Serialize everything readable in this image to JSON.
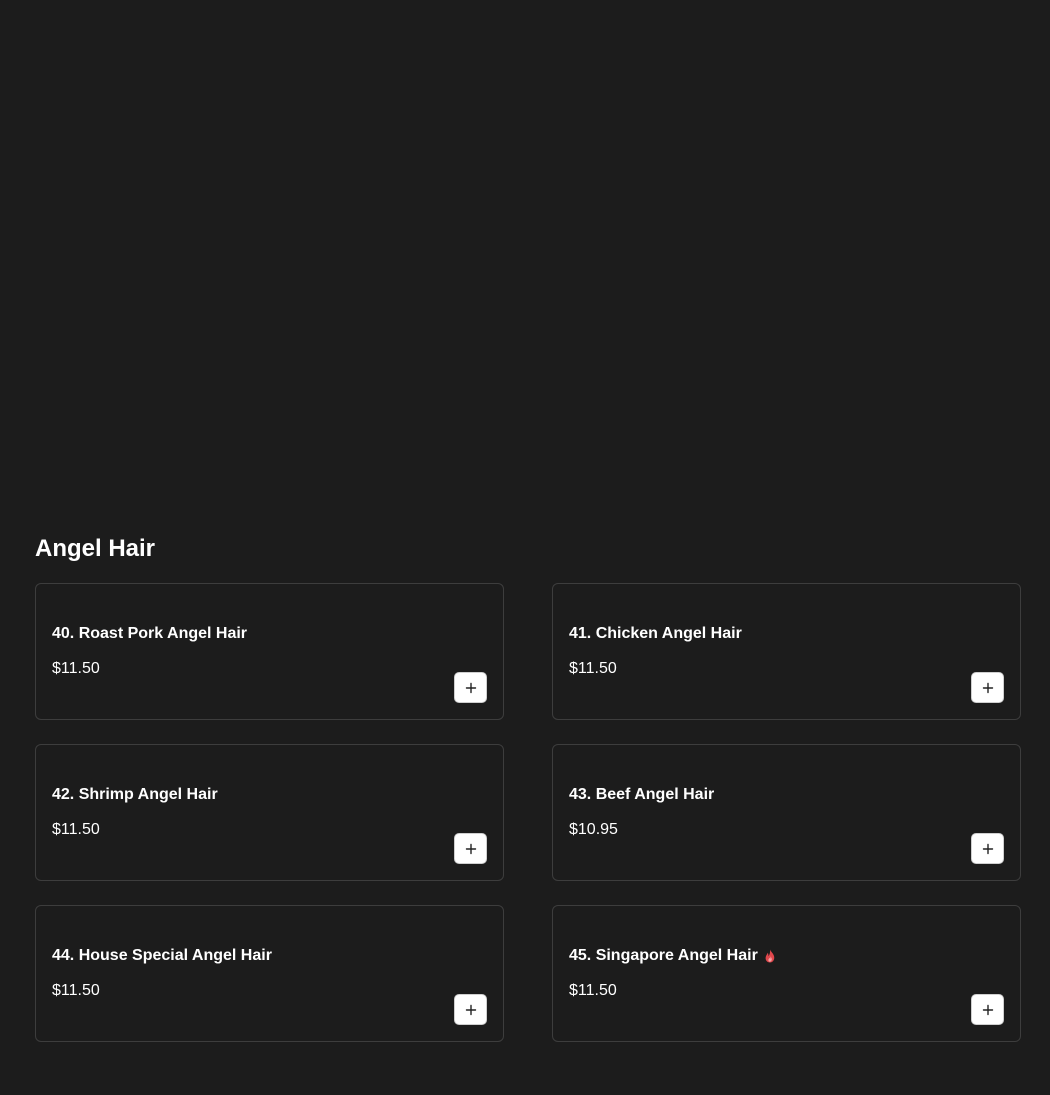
{
  "section": {
    "title": "Angel Hair"
  },
  "items": [
    {
      "name": "40. Roast Pork Angel Hair",
      "price": "$11.50",
      "spicy": false
    },
    {
      "name": "41. Chicken Angel Hair",
      "price": "$11.50",
      "spicy": false
    },
    {
      "name": "42. Shrimp Angel Hair",
      "price": "$11.50",
      "spicy": false
    },
    {
      "name": "43. Beef Angel Hair",
      "price": "$10.95",
      "spicy": false
    },
    {
      "name": "44. House Special Angel Hair",
      "price": "$11.50",
      "spicy": false
    },
    {
      "name": "45. Singapore Angel Hair",
      "price": "$11.50",
      "spicy": true
    }
  ],
  "icons": {
    "add": "plus-icon",
    "spicy": "flame-icon"
  },
  "colors": {
    "background": "#1c1c1c",
    "card_border": "#3d3d3d",
    "spicy": "#e0474c"
  }
}
